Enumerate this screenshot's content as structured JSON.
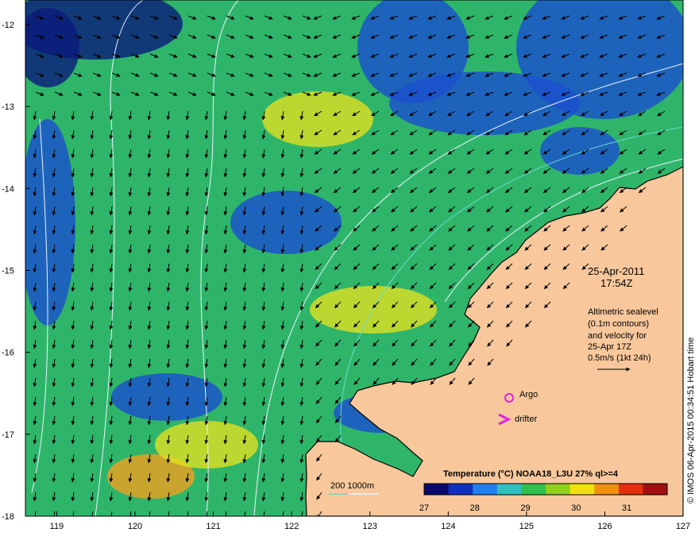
{
  "map": {
    "colors": {
      "land": "#f8c89c",
      "coast": "#000000",
      "ocean_base": "#2fb56a",
      "warm_patch": "#e0e020",
      "hot_patch": "#f0a020",
      "cool_patch": "#1a4fd0",
      "cold_patch": "#0a1a7a",
      "contour": "#e8f4ff",
      "shallow_contour": "#66ddcc",
      "marker": "#e020e0"
    },
    "y_ticks": [
      "-12",
      "-13",
      "-14",
      "-15",
      "-16",
      "-17",
      "-18"
    ],
    "x_ticks": [
      "119",
      "120",
      "121",
      "122",
      "123",
      "124",
      "125",
      "126",
      "127"
    ],
    "lon_range": [
      118.6,
      127.0
    ],
    "lat_range": [
      -11.7,
      -18.0
    ]
  },
  "annotation": {
    "date": "25-Apr-2011",
    "time": "17:54Z",
    "desc_line1": "Altimetric sealevel",
    "desc_line2": "(0.1m contours)",
    "desc_line3": "and velocity for",
    "desc_line4": "25-Apr 17Z",
    "scale_label": "0.5m/s (1kt 24h)"
  },
  "legend": {
    "argo": "Argo",
    "drifter": "drifter",
    "bathy": "200  1000m",
    "colorbar_title": "Temperature (°C) NOAA18_L3U 27% ql>=4",
    "colorbar_ticks": [
      "27",
      "28",
      "29",
      "30",
      "31"
    ],
    "colorbar_range": [
      27,
      31.8
    ],
    "colorbar_colors": [
      "#0a0a6e",
      "#1030c0",
      "#2080f0",
      "#30c0c0",
      "#30c050",
      "#90d020",
      "#f0e010",
      "#f09010",
      "#e03010",
      "#a01010"
    ]
  },
  "credit": "© IMOS 06-Apr-2015 00:34:51 Hobart time"
}
